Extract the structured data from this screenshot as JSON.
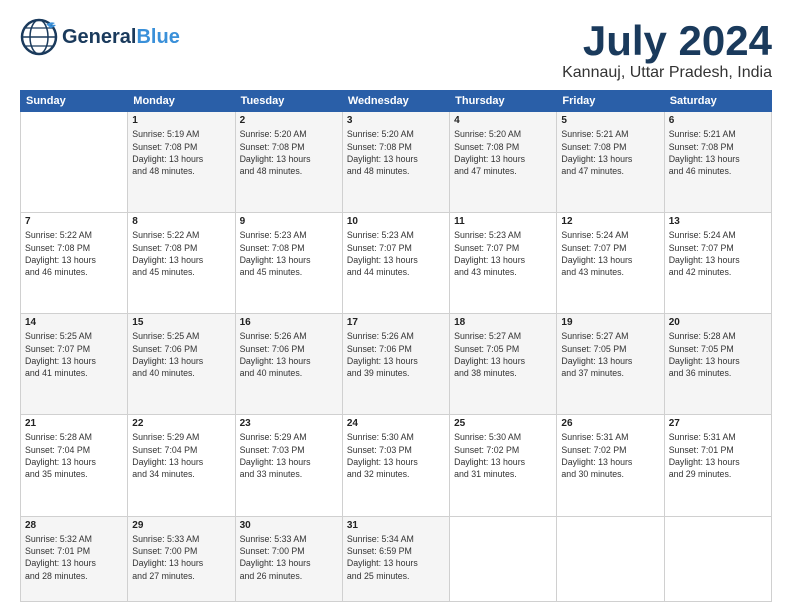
{
  "header": {
    "logo_general": "General",
    "logo_blue": "Blue",
    "month_title": "July 2024",
    "location": "Kannauj, Uttar Pradesh, India"
  },
  "days_of_week": [
    "Sunday",
    "Monday",
    "Tuesday",
    "Wednesday",
    "Thursday",
    "Friday",
    "Saturday"
  ],
  "weeks": [
    [
      {
        "num": "",
        "info": ""
      },
      {
        "num": "1",
        "info": "Sunrise: 5:19 AM\nSunset: 7:08 PM\nDaylight: 13 hours\nand 48 minutes."
      },
      {
        "num": "2",
        "info": "Sunrise: 5:20 AM\nSunset: 7:08 PM\nDaylight: 13 hours\nand 48 minutes."
      },
      {
        "num": "3",
        "info": "Sunrise: 5:20 AM\nSunset: 7:08 PM\nDaylight: 13 hours\nand 48 minutes."
      },
      {
        "num": "4",
        "info": "Sunrise: 5:20 AM\nSunset: 7:08 PM\nDaylight: 13 hours\nand 47 minutes."
      },
      {
        "num": "5",
        "info": "Sunrise: 5:21 AM\nSunset: 7:08 PM\nDaylight: 13 hours\nand 47 minutes."
      },
      {
        "num": "6",
        "info": "Sunrise: 5:21 AM\nSunset: 7:08 PM\nDaylight: 13 hours\nand 46 minutes."
      }
    ],
    [
      {
        "num": "7",
        "info": "Sunrise: 5:22 AM\nSunset: 7:08 PM\nDaylight: 13 hours\nand 46 minutes."
      },
      {
        "num": "8",
        "info": "Sunrise: 5:22 AM\nSunset: 7:08 PM\nDaylight: 13 hours\nand 45 minutes."
      },
      {
        "num": "9",
        "info": "Sunrise: 5:23 AM\nSunset: 7:08 PM\nDaylight: 13 hours\nand 45 minutes."
      },
      {
        "num": "10",
        "info": "Sunrise: 5:23 AM\nSunset: 7:07 PM\nDaylight: 13 hours\nand 44 minutes."
      },
      {
        "num": "11",
        "info": "Sunrise: 5:23 AM\nSunset: 7:07 PM\nDaylight: 13 hours\nand 43 minutes."
      },
      {
        "num": "12",
        "info": "Sunrise: 5:24 AM\nSunset: 7:07 PM\nDaylight: 13 hours\nand 43 minutes."
      },
      {
        "num": "13",
        "info": "Sunrise: 5:24 AM\nSunset: 7:07 PM\nDaylight: 13 hours\nand 42 minutes."
      }
    ],
    [
      {
        "num": "14",
        "info": "Sunrise: 5:25 AM\nSunset: 7:07 PM\nDaylight: 13 hours\nand 41 minutes."
      },
      {
        "num": "15",
        "info": "Sunrise: 5:25 AM\nSunset: 7:06 PM\nDaylight: 13 hours\nand 40 minutes."
      },
      {
        "num": "16",
        "info": "Sunrise: 5:26 AM\nSunset: 7:06 PM\nDaylight: 13 hours\nand 40 minutes."
      },
      {
        "num": "17",
        "info": "Sunrise: 5:26 AM\nSunset: 7:06 PM\nDaylight: 13 hours\nand 39 minutes."
      },
      {
        "num": "18",
        "info": "Sunrise: 5:27 AM\nSunset: 7:05 PM\nDaylight: 13 hours\nand 38 minutes."
      },
      {
        "num": "19",
        "info": "Sunrise: 5:27 AM\nSunset: 7:05 PM\nDaylight: 13 hours\nand 37 minutes."
      },
      {
        "num": "20",
        "info": "Sunrise: 5:28 AM\nSunset: 7:05 PM\nDaylight: 13 hours\nand 36 minutes."
      }
    ],
    [
      {
        "num": "21",
        "info": "Sunrise: 5:28 AM\nSunset: 7:04 PM\nDaylight: 13 hours\nand 35 minutes."
      },
      {
        "num": "22",
        "info": "Sunrise: 5:29 AM\nSunset: 7:04 PM\nDaylight: 13 hours\nand 34 minutes."
      },
      {
        "num": "23",
        "info": "Sunrise: 5:29 AM\nSunset: 7:03 PM\nDaylight: 13 hours\nand 33 minutes."
      },
      {
        "num": "24",
        "info": "Sunrise: 5:30 AM\nSunset: 7:03 PM\nDaylight: 13 hours\nand 32 minutes."
      },
      {
        "num": "25",
        "info": "Sunrise: 5:30 AM\nSunset: 7:02 PM\nDaylight: 13 hours\nand 31 minutes."
      },
      {
        "num": "26",
        "info": "Sunrise: 5:31 AM\nSunset: 7:02 PM\nDaylight: 13 hours\nand 30 minutes."
      },
      {
        "num": "27",
        "info": "Sunrise: 5:31 AM\nSunset: 7:01 PM\nDaylight: 13 hours\nand 29 minutes."
      }
    ],
    [
      {
        "num": "28",
        "info": "Sunrise: 5:32 AM\nSunset: 7:01 PM\nDaylight: 13 hours\nand 28 minutes."
      },
      {
        "num": "29",
        "info": "Sunrise: 5:33 AM\nSunset: 7:00 PM\nDaylight: 13 hours\nand 27 minutes."
      },
      {
        "num": "30",
        "info": "Sunrise: 5:33 AM\nSunset: 7:00 PM\nDaylight: 13 hours\nand 26 minutes."
      },
      {
        "num": "31",
        "info": "Sunrise: 5:34 AM\nSunset: 6:59 PM\nDaylight: 13 hours\nand 25 minutes."
      },
      {
        "num": "",
        "info": ""
      },
      {
        "num": "",
        "info": ""
      },
      {
        "num": "",
        "info": ""
      }
    ]
  ]
}
